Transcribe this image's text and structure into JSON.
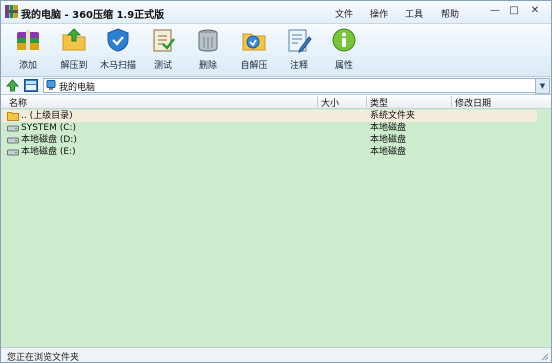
{
  "window": {
    "title": "我的电脑 - 360压缩 1.9正式版"
  },
  "menu": [
    "文件",
    "操作",
    "工具",
    "帮助"
  ],
  "window_buttons": {
    "minimize": "—",
    "maximize": "□",
    "close": "✕"
  },
  "toolbar": [
    {
      "label": "添加",
      "icon": "add-archive-icon"
    },
    {
      "label": "解压到",
      "icon": "extract-icon"
    },
    {
      "label": "木马扫描",
      "icon": "shield-scan-icon"
    },
    {
      "label": "测试",
      "icon": "test-checklist-icon"
    },
    {
      "label": "删除",
      "icon": "trash-icon"
    },
    {
      "label": "自解压",
      "icon": "self-extract-icon"
    },
    {
      "label": "注释",
      "icon": "comment-icon"
    },
    {
      "label": "属性",
      "icon": "info-icon"
    }
  ],
  "address": {
    "path": "我的电脑",
    "dropdown": "▼"
  },
  "columns": {
    "name": "名称",
    "size": "大小",
    "type": "类型",
    "date": "修改日期"
  },
  "rows": [
    {
      "name": ".. (上级目录)",
      "size": "",
      "type": "系统文件夹",
      "date": "",
      "icon": "folder-icon"
    },
    {
      "name": "SYSTEM (C:)",
      "size": "",
      "type": "本地磁盘",
      "date": "",
      "icon": "drive-icon"
    },
    {
      "name": "本地磁盘 (D:)",
      "size": "",
      "type": "本地磁盘",
      "date": "",
      "icon": "drive-icon"
    },
    {
      "name": "本地磁盘 (E:)",
      "size": "",
      "type": "本地磁盘",
      "date": "",
      "icon": "drive-icon"
    }
  ],
  "status": {
    "text": "您正在浏览文件夹"
  },
  "colors": {
    "list_background": "#cdeccd",
    "parent_row": "#f3ecdb",
    "accent": "#3a7bc8"
  }
}
